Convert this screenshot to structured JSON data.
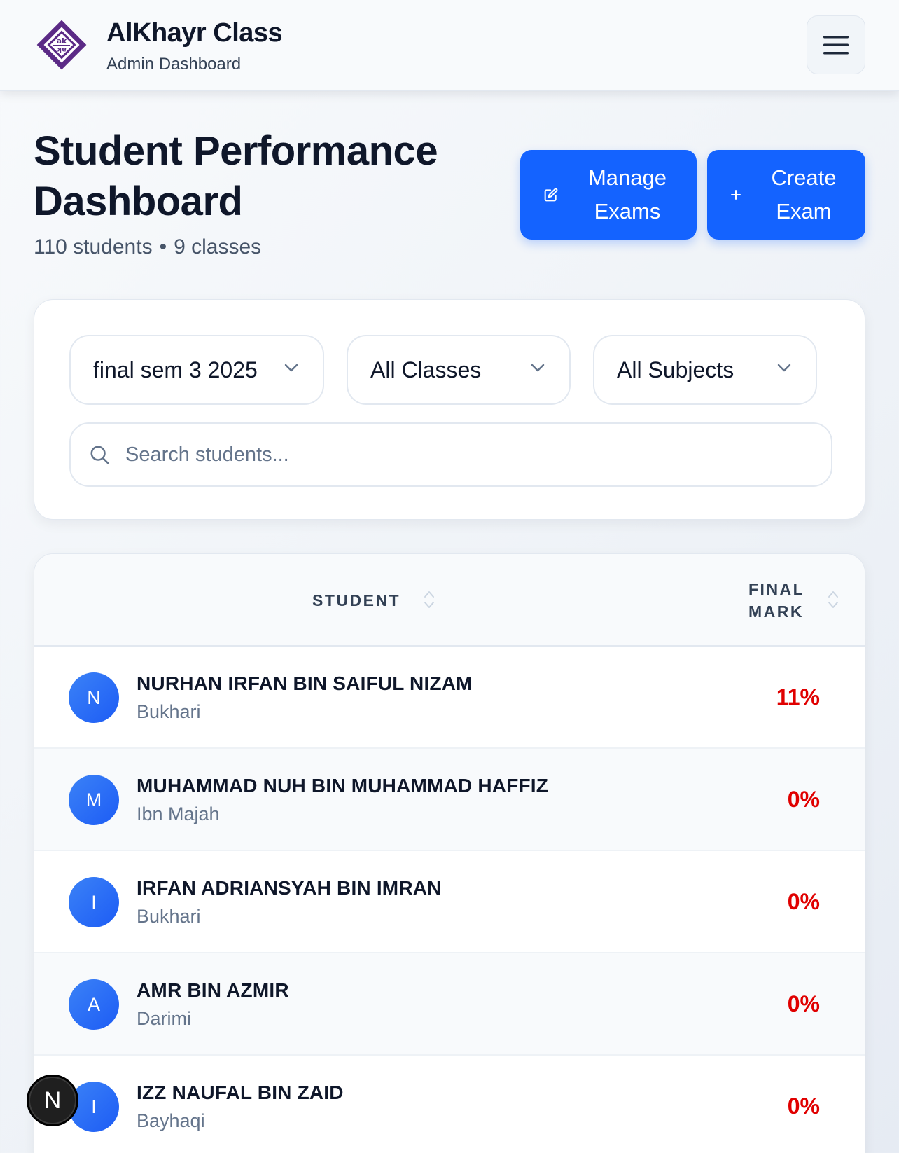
{
  "header": {
    "brand_title": "AlKhayr Class",
    "brand_subtitle": "Admin Dashboard"
  },
  "page": {
    "title": "Student Performance Dashboard",
    "students_count": "110 students",
    "separator": "•",
    "classes_count": "9 classes"
  },
  "actions": {
    "manage_label": "Manage Exams",
    "create_label": "Create Exam"
  },
  "filters": {
    "exam": "final sem 3 2025",
    "class": "All Classes",
    "subject": "All Subjects",
    "search_placeholder": "Search students..."
  },
  "table": {
    "columns": {
      "student": "STUDENT",
      "final_mark": "FINAL MARK"
    },
    "rows": [
      {
        "initial": "N",
        "name": "NURHAN IRFAN BIN SAIFUL NIZAM",
        "class": "Bukhari",
        "mark": "11%"
      },
      {
        "initial": "M",
        "name": "MUHAMMAD NUH BIN MUHAMMAD HAFFIZ",
        "class": "Ibn Majah",
        "mark": "0%"
      },
      {
        "initial": "I",
        "name": "IRFAN ADRIANSYAH BIN IMRAN",
        "class": "Bukhari",
        "mark": "0%"
      },
      {
        "initial": "A",
        "name": "AMR BIN AZMIR",
        "class": "Darimi",
        "mark": "0%"
      },
      {
        "initial": "I",
        "name": "IZZ NAUFAL BIN ZAID",
        "class": "Bayhaqi",
        "mark": "0%"
      }
    ]
  },
  "fab": {
    "letter": "N"
  },
  "colors": {
    "primary": "#1463ff",
    "mark_low": "#e00000",
    "logo_purple": "#5b2a86"
  }
}
